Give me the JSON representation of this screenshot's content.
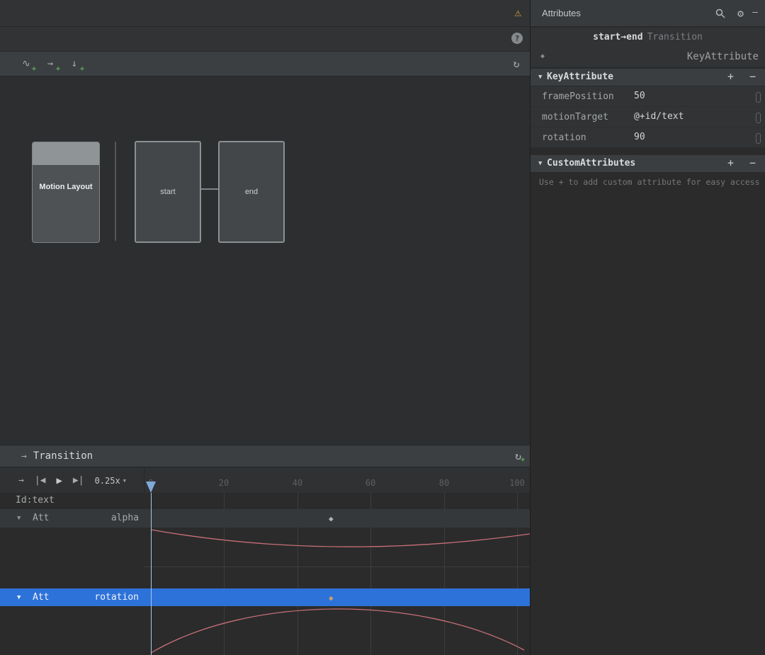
{
  "top": {
    "warning_icon": "⚠",
    "help_icon": "?"
  },
  "design": {
    "toolbar": {
      "transition_icon": "∿",
      "arrow_icon": "→",
      "keyframe_icon": "↓",
      "plus_badge": "+",
      "refresh_icon": "↻"
    },
    "component_label": "Motion Layout",
    "start_label": "start",
    "end_label": "end"
  },
  "attributes": {
    "title": "Attributes",
    "gear_icon": "⚙",
    "minimize_icon": "—",
    "transition_states": "start→end",
    "transition_label": "Transition",
    "selected_icon": "◆",
    "selected_label": "KeyAttribute",
    "collapse_icon": "▼",
    "key_section": {
      "title": "KeyAttribute",
      "add": "+",
      "remove": "−",
      "rows": [
        {
          "key": "framePosition",
          "value": "50"
        },
        {
          "key": "motionTarget",
          "value": "@+id/text"
        },
        {
          "key": "rotation",
          "value": "90"
        }
      ]
    },
    "custom_section": {
      "title": "CustomAttributes",
      "add": "+",
      "remove": "−",
      "hint": "Use + to add custom attribute for easy access"
    }
  },
  "timeline": {
    "arrow_icon": "→",
    "title": "Transition",
    "cycle_icon": "↻",
    "cycle_plus": "+",
    "controls": {
      "direction": "→",
      "skip_start": "|◀",
      "play": "▶",
      "skip_end": "▶|",
      "speed": "0.25x",
      "caret": "▼"
    },
    "ticks": [
      "0",
      "20",
      "40",
      "60",
      "80",
      "100"
    ],
    "id_label": "Id:text",
    "tracks": [
      {
        "caret": "▼",
        "group": "Att",
        "name": "alpha",
        "keyframe": "◆"
      },
      {
        "caret": "▼",
        "group": "Att",
        "name": "rotation",
        "keyframe": "◆"
      }
    ]
  }
}
